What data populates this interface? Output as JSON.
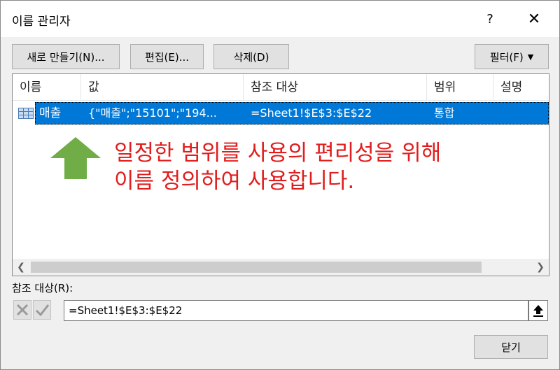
{
  "window": {
    "title": "이름 관리자",
    "help_label": "?",
    "close_label": "✕"
  },
  "toolbar": {
    "new_label": "새로 만들기(N)...",
    "edit_label": "편집(E)...",
    "delete_label": "삭제(D)",
    "filter_label": "필터(F)"
  },
  "table": {
    "columns": [
      "이름",
      "값",
      "참조 대상",
      "범위",
      "설명"
    ],
    "rows": [
      {
        "name": "매출",
        "value": "{\"매출\";\"15101\";\"194...",
        "refers_to": "=Sheet1!$E$3:$E$22",
        "scope": "통합",
        "comment": ""
      }
    ]
  },
  "annotation": {
    "line1": "일정한 범위를 사용의 편리성을 위해",
    "line2": "이름 정의하여 사용합니다.",
    "color": "#e11d1d",
    "arrow_color": "#70ad47"
  },
  "refers_to_section": {
    "label": "참조 대상(R):",
    "value": "=Sheet1!$E$3:$E$22"
  },
  "footer": {
    "close_button_label": "닫기"
  },
  "colors": {
    "selection": "#0078d7",
    "background": "#f0f0f0"
  }
}
